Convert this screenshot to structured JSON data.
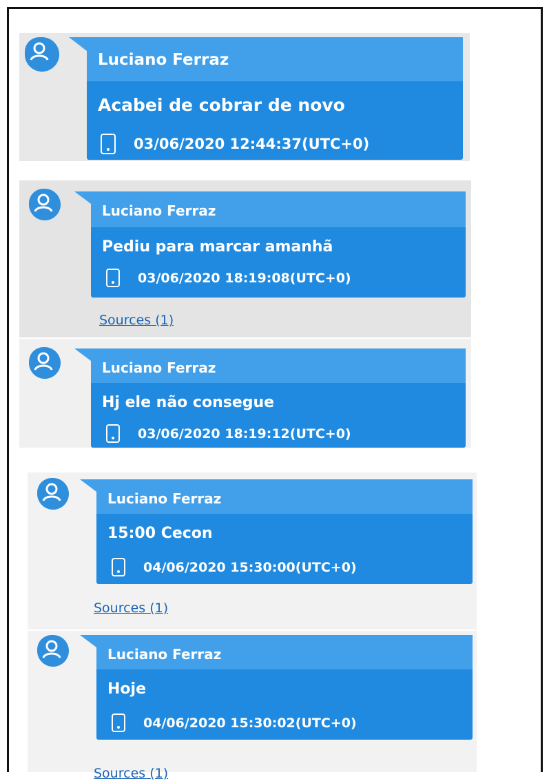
{
  "messages": [
    {
      "sender": "Luciano Ferraz",
      "text": "Acabei de cobrar de novo",
      "timestamp": "03/06/2020 12:44:37(UTC+0)",
      "icon": "phone-icon"
    },
    {
      "sender": "Luciano Ferraz",
      "text": "Pediu para marcar amanhã",
      "timestamp": "03/06/2020 18:19:08(UTC+0)",
      "icon": "phone-icon",
      "sources": "Sources (1)"
    },
    {
      "sender": "Luciano Ferraz",
      "text": "Hj ele não consegue",
      "timestamp": "03/06/2020 18:19:12(UTC+0)",
      "icon": "phone-icon"
    },
    {
      "sender": "Luciano Ferraz",
      "text": "15:00 Cecon",
      "timestamp": "04/06/2020 15:30:00(UTC+0)",
      "icon": "phone-icon",
      "sources": "Sources (1)"
    },
    {
      "sender": "Luciano Ferraz",
      "text": "Hoje",
      "timestamp": "04/06/2020 15:30:02(UTC+0)",
      "icon": "phone-icon",
      "sources": "Sources (1)"
    }
  ],
  "colors": {
    "bubble": "#1f8ae0",
    "bubble_header": "#42a0ea",
    "avatar": "#2f8fdc",
    "link": "#1a64b5",
    "panel_gray": "#e6e6e6"
  }
}
